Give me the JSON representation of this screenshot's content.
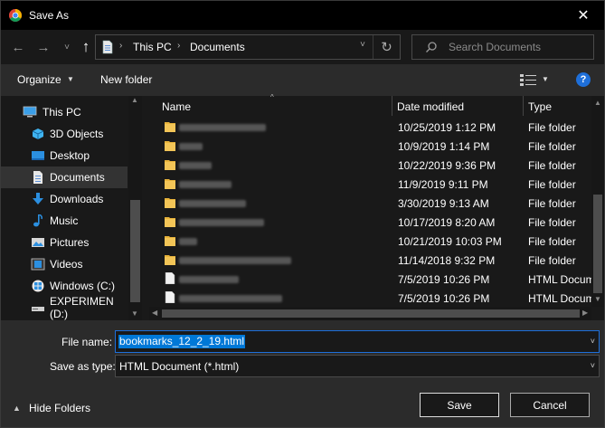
{
  "window": {
    "title": "Save As",
    "close_glyph": "✕"
  },
  "nav": {
    "back_glyph": "←",
    "forward_glyph": "→",
    "recent_glyph": "˅",
    "up_glyph": "↑",
    "breadcrumb": [
      "This PC",
      "Documents"
    ],
    "breadcrumb_sep": "›",
    "dropdown_glyph": "˅",
    "refresh_glyph": "↻",
    "search_placeholder": "Search Documents"
  },
  "toolbar": {
    "organize_label": "Organize",
    "caret": "▼",
    "new_folder_label": "New folder",
    "help_label": "?"
  },
  "sidebar": {
    "items": [
      {
        "label": "This PC",
        "icon": "pc-icon"
      },
      {
        "label": "3D Objects",
        "icon": "cube-icon"
      },
      {
        "label": "Desktop",
        "icon": "desktop-icon"
      },
      {
        "label": "Documents",
        "icon": "document-icon",
        "selected": true
      },
      {
        "label": "Downloads",
        "icon": "download-icon"
      },
      {
        "label": "Music",
        "icon": "music-icon"
      },
      {
        "label": "Pictures",
        "icon": "picture-icon"
      },
      {
        "label": "Videos",
        "icon": "video-icon"
      },
      {
        "label": "Windows (C:)",
        "icon": "drive-windows-icon"
      },
      {
        "label": "EXPERIMEN (D:)",
        "icon": "drive-icon"
      }
    ]
  },
  "filelist": {
    "columns": {
      "name": "Name",
      "date": "Date modified",
      "type": "Type"
    },
    "sort_glyph": "^",
    "rows": [
      {
        "kind": "folder",
        "date": "10/25/2019 1:12 PM",
        "type": "File folder"
      },
      {
        "kind": "folder",
        "date": "10/9/2019 1:14 PM",
        "type": "File folder"
      },
      {
        "kind": "folder",
        "date": "10/22/2019 9:36 PM",
        "type": "File folder"
      },
      {
        "kind": "folder",
        "date": "11/9/2019 9:11 PM",
        "type": "File folder"
      },
      {
        "kind": "folder",
        "date": "3/30/2019 9:13 AM",
        "type": "File folder"
      },
      {
        "kind": "folder",
        "date": "10/17/2019 8:20 AM",
        "type": "File folder"
      },
      {
        "kind": "folder",
        "date": "10/21/2019 10:03 PM",
        "type": "File folder"
      },
      {
        "kind": "folder",
        "date": "11/14/2018 9:32 PM",
        "type": "File folder"
      },
      {
        "kind": "file",
        "date": "7/5/2019 10:26 PM",
        "type": "HTML Document"
      },
      {
        "kind": "file",
        "date": "7/5/2019 10:26 PM",
        "type": "HTML Document"
      }
    ]
  },
  "save": {
    "file_name_label": "File name:",
    "file_name_value": "bookmarks_12_2_19.html",
    "save_type_label": "Save as type:",
    "save_type_value": "HTML Document (*.html)",
    "dropdown_glyph": "˅",
    "hide_folders_label": "Hide Folders",
    "hide_caret": "▲",
    "save_button": "Save",
    "cancel_button": "Cancel"
  },
  "colors": {
    "background": "#191919",
    "toolbar": "#2b2b2b",
    "accent": "#0078d7",
    "folder": "#e8b33a"
  }
}
